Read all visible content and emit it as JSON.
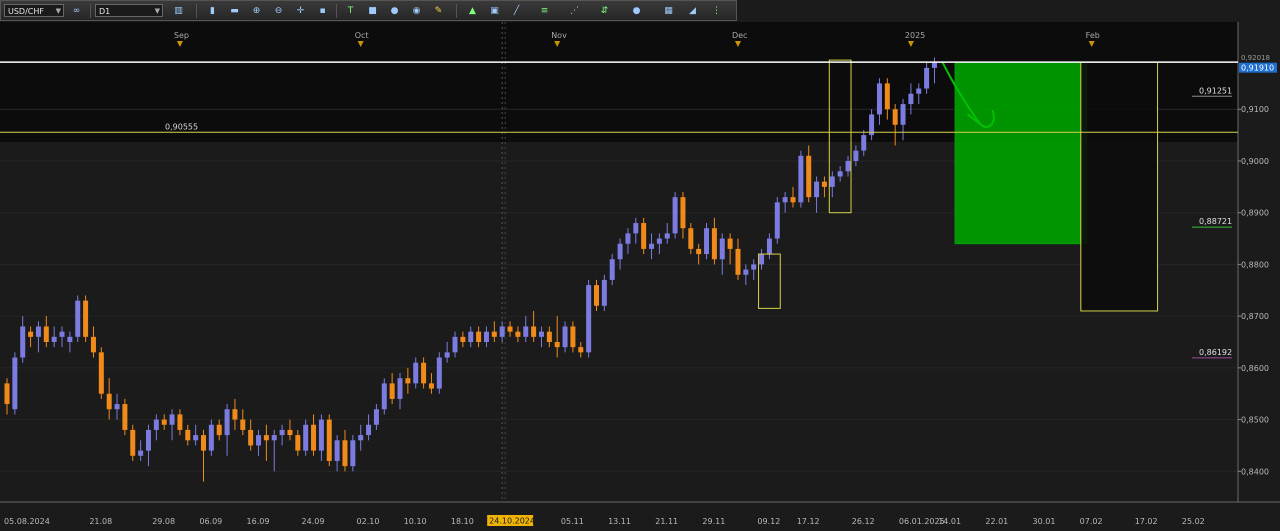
{
  "toolbar": {
    "symbol": "USD/CHF",
    "timeframe": "D1",
    "link_icon": "link-icon",
    "chart_type_icon": "candles-icon"
  },
  "colors": {
    "bull": "#7b7be0",
    "bear": "#f08a1a",
    "level": "#d8d24a",
    "target_box": "#00a000",
    "line_white": "#ffffff",
    "background": "#1b1b1b",
    "upper_zone": "#0c0c0c"
  },
  "chart_data": {
    "type": "candlestick",
    "symbol": "USD/CHF",
    "timeframe": "D1",
    "ylim": [
      0.836,
      0.923
    ],
    "price_ticks": [
      "0,9100",
      "0,9000",
      "0,8900",
      "0,8800",
      "0,8700",
      "0,8600",
      "0,8500",
      "0,8400"
    ],
    "price_tick_values": [
      0.91,
      0.9,
      0.89,
      0.88,
      0.87,
      0.86,
      0.85,
      0.84
    ],
    "date_ticks": [
      "05.08.2024",
      "21.08",
      "29.08",
      "06.09",
      "16.09",
      "24.09",
      "02.10",
      "10.10",
      "18.10",
      "24.10.2024",
      "05.11",
      "13.11",
      "21.11",
      "29.11",
      "09.12",
      "17.12",
      "26.12",
      "06.01.2025",
      "14.01",
      "22.01",
      "30.01",
      "07.02",
      "17.02",
      "25.02"
    ],
    "date_tick_bars": [
      0,
      12,
      20,
      26,
      32,
      39,
      46,
      52,
      58,
      63,
      72,
      78,
      84,
      90,
      97,
      102,
      109,
      115,
      120,
      126,
      132,
      138,
      145,
      151
    ],
    "month_markers": [
      "Sep",
      "Oct",
      "Nov",
      "Dec",
      "2025",
      "Feb"
    ],
    "month_marker_bars": [
      22,
      45,
      70,
      93,
      115,
      138
    ],
    "highlighted_date": "24.10.2024",
    "highlighted_bar": 63,
    "current_price": "0,91910",
    "current_price_top": "0,92018",
    "levels": [
      {
        "label": "0,90555",
        "value": 0.90555
      },
      {
        "label": "0,91910",
        "value": 0.9191
      }
    ],
    "right_labels": [
      {
        "label": "0,91251",
        "value": 0.91251
      },
      {
        "label": "0,88721",
        "value": 0.88721
      },
      {
        "label": "0,86192",
        "value": 0.86192
      }
    ],
    "ohlc": [
      [
        0.857,
        0.858,
        0.851,
        0.853
      ],
      [
        0.852,
        0.863,
        0.851,
        0.862
      ],
      [
        0.862,
        0.87,
        0.861,
        0.868
      ],
      [
        0.867,
        0.868,
        0.864,
        0.866
      ],
      [
        0.866,
        0.869,
        0.863,
        0.868
      ],
      [
        0.868,
        0.87,
        0.864,
        0.865
      ],
      [
        0.865,
        0.868,
        0.864,
        0.866
      ],
      [
        0.866,
        0.868,
        0.864,
        0.867
      ],
      [
        0.865,
        0.867,
        0.863,
        0.866
      ],
      [
        0.866,
        0.874,
        0.865,
        0.873
      ],
      [
        0.873,
        0.874,
        0.865,
        0.866
      ],
      [
        0.866,
        0.868,
        0.862,
        0.863
      ],
      [
        0.863,
        0.864,
        0.854,
        0.855
      ],
      [
        0.855,
        0.858,
        0.85,
        0.852
      ],
      [
        0.852,
        0.855,
        0.85,
        0.853
      ],
      [
        0.853,
        0.854,
        0.847,
        0.848
      ],
      [
        0.848,
        0.849,
        0.842,
        0.843
      ],
      [
        0.843,
        0.846,
        0.842,
        0.844
      ],
      [
        0.844,
        0.849,
        0.841,
        0.848
      ],
      [
        0.848,
        0.851,
        0.846,
        0.85
      ],
      [
        0.85,
        0.851,
        0.848,
        0.849
      ],
      [
        0.849,
        0.852,
        0.846,
        0.851
      ],
      [
        0.851,
        0.852,
        0.847,
        0.848
      ],
      [
        0.848,
        0.849,
        0.845,
        0.846
      ],
      [
        0.846,
        0.849,
        0.845,
        0.847
      ],
      [
        0.847,
        0.848,
        0.838,
        0.844
      ],
      [
        0.844,
        0.85,
        0.843,
        0.849
      ],
      [
        0.849,
        0.85,
        0.846,
        0.847
      ],
      [
        0.847,
        0.853,
        0.843,
        0.852
      ],
      [
        0.852,
        0.854,
        0.848,
        0.85
      ],
      [
        0.85,
        0.852,
        0.847,
        0.848
      ],
      [
        0.848,
        0.85,
        0.844,
        0.845
      ],
      [
        0.845,
        0.848,
        0.843,
        0.847
      ],
      [
        0.847,
        0.849,
        0.842,
        0.846
      ],
      [
        0.846,
        0.848,
        0.84,
        0.847
      ],
      [
        0.847,
        0.849,
        0.845,
        0.848
      ],
      [
        0.848,
        0.85,
        0.846,
        0.847
      ],
      [
        0.847,
        0.848,
        0.843,
        0.844
      ],
      [
        0.844,
        0.85,
        0.843,
        0.849
      ],
      [
        0.849,
        0.851,
        0.843,
        0.844
      ],
      [
        0.844,
        0.851,
        0.842,
        0.85
      ],
      [
        0.85,
        0.851,
        0.841,
        0.842
      ],
      [
        0.842,
        0.847,
        0.84,
        0.846
      ],
      [
        0.846,
        0.848,
        0.84,
        0.841
      ],
      [
        0.841,
        0.847,
        0.84,
        0.846
      ],
      [
        0.846,
        0.849,
        0.844,
        0.847
      ],
      [
        0.847,
        0.851,
        0.846,
        0.849
      ],
      [
        0.849,
        0.853,
        0.848,
        0.852
      ],
      [
        0.852,
        0.858,
        0.851,
        0.857
      ],
      [
        0.857,
        0.859,
        0.853,
        0.854
      ],
      [
        0.854,
        0.859,
        0.852,
        0.858
      ],
      [
        0.858,
        0.86,
        0.855,
        0.857
      ],
      [
        0.857,
        0.862,
        0.856,
        0.861
      ],
      [
        0.861,
        0.862,
        0.856,
        0.857
      ],
      [
        0.857,
        0.859,
        0.855,
        0.856
      ],
      [
        0.856,
        0.863,
        0.855,
        0.862
      ],
      [
        0.862,
        0.865,
        0.861,
        0.863
      ],
      [
        0.863,
        0.867,
        0.862,
        0.866
      ],
      [
        0.866,
        0.867,
        0.864,
        0.865
      ],
      [
        0.865,
        0.868,
        0.864,
        0.867
      ],
      [
        0.867,
        0.868,
        0.864,
        0.865
      ],
      [
        0.865,
        0.868,
        0.864,
        0.867
      ],
      [
        0.867,
        0.869,
        0.865,
        0.866
      ],
      [
        0.866,
        0.869,
        0.865,
        0.868
      ],
      [
        0.868,
        0.869,
        0.866,
        0.867
      ],
      [
        0.867,
        0.868,
        0.865,
        0.866
      ],
      [
        0.866,
        0.87,
        0.865,
        0.868
      ],
      [
        0.868,
        0.871,
        0.865,
        0.866
      ],
      [
        0.866,
        0.868,
        0.864,
        0.867
      ],
      [
        0.867,
        0.868,
        0.864,
        0.865
      ],
      [
        0.865,
        0.87,
        0.862,
        0.864
      ],
      [
        0.864,
        0.869,
        0.863,
        0.868
      ],
      [
        0.868,
        0.869,
        0.863,
        0.864
      ],
      [
        0.864,
        0.865,
        0.862,
        0.863
      ],
      [
        0.863,
        0.877,
        0.862,
        0.876
      ],
      [
        0.876,
        0.877,
        0.871,
        0.872
      ],
      [
        0.872,
        0.878,
        0.871,
        0.877
      ],
      [
        0.877,
        0.882,
        0.876,
        0.881
      ],
      [
        0.881,
        0.885,
        0.879,
        0.884
      ],
      [
        0.884,
        0.887,
        0.882,
        0.886
      ],
      [
        0.886,
        0.889,
        0.884,
        0.888
      ],
      [
        0.888,
        0.889,
        0.882,
        0.883
      ],
      [
        0.883,
        0.886,
        0.881,
        0.884
      ],
      [
        0.884,
        0.886,
        0.882,
        0.885
      ],
      [
        0.885,
        0.888,
        0.884,
        0.886
      ],
      [
        0.886,
        0.894,
        0.885,
        0.893
      ],
      [
        0.893,
        0.894,
        0.885,
        0.887
      ],
      [
        0.887,
        0.888,
        0.882,
        0.883
      ],
      [
        0.883,
        0.884,
        0.88,
        0.882
      ],
      [
        0.882,
        0.888,
        0.881,
        0.887
      ],
      [
        0.887,
        0.889,
        0.88,
        0.881
      ],
      [
        0.881,
        0.886,
        0.878,
        0.885
      ],
      [
        0.885,
        0.886,
        0.88,
        0.883
      ],
      [
        0.883,
        0.885,
        0.877,
        0.878
      ],
      [
        0.878,
        0.88,
        0.876,
        0.879
      ],
      [
        0.879,
        0.881,
        0.877,
        0.88
      ],
      [
        0.88,
        0.883,
        0.879,
        0.882
      ],
      [
        0.882,
        0.886,
        0.881,
        0.885
      ],
      [
        0.885,
        0.893,
        0.884,
        0.892
      ],
      [
        0.892,
        0.894,
        0.89,
        0.893
      ],
      [
        0.893,
        0.895,
        0.891,
        0.892
      ],
      [
        0.892,
        0.902,
        0.891,
        0.901
      ],
      [
        0.901,
        0.903,
        0.892,
        0.893
      ],
      [
        0.893,
        0.897,
        0.89,
        0.896
      ],
      [
        0.896,
        0.897,
        0.893,
        0.895
      ],
      [
        0.895,
        0.898,
        0.893,
        0.897
      ],
      [
        0.897,
        0.899,
        0.896,
        0.898
      ],
      [
        0.898,
        0.901,
        0.897,
        0.9
      ],
      [
        0.9,
        0.903,
        0.899,
        0.902
      ],
      [
        0.902,
        0.906,
        0.901,
        0.905
      ],
      [
        0.905,
        0.91,
        0.904,
        0.909
      ],
      [
        0.909,
        0.916,
        0.907,
        0.915
      ],
      [
        0.915,
        0.916,
        0.908,
        0.91
      ],
      [
        0.91,
        0.911,
        0.903,
        0.907
      ],
      [
        0.907,
        0.912,
        0.904,
        0.911
      ],
      [
        0.911,
        0.915,
        0.909,
        0.913
      ],
      [
        0.913,
        0.915,
        0.911,
        0.914
      ],
      [
        0.914,
        0.919,
        0.913,
        0.918
      ],
      [
        0.918,
        0.92,
        0.915,
        0.9191
      ]
    ],
    "drawings": [
      {
        "type": "rectangle",
        "color": "#d8d24a",
        "fill": "none",
        "bar_from": 96,
        "bar_to": 98,
        "price_top": 0.882,
        "price_bottom": 0.8715
      },
      {
        "type": "rectangle",
        "color": "#d8d24a",
        "fill": "none",
        "bar_from": 105,
        "bar_to": 107,
        "price_top": 0.9195,
        "price_bottom": 0.89
      },
      {
        "type": "rectangle",
        "color": "#00a000",
        "fill": "#00a000",
        "bar_from": 121,
        "bar_to": 137,
        "price_top": 0.9191,
        "price_bottom": 0.884
      },
      {
        "type": "rectangle",
        "color": "#d8d24a",
        "fill": "#0c0c0c",
        "bar_from": 137,
        "bar_to": 146,
        "price_top": 0.9191,
        "price_bottom": 0.871
      },
      {
        "type": "freehand-arrow",
        "color": "#00c000"
      }
    ]
  }
}
